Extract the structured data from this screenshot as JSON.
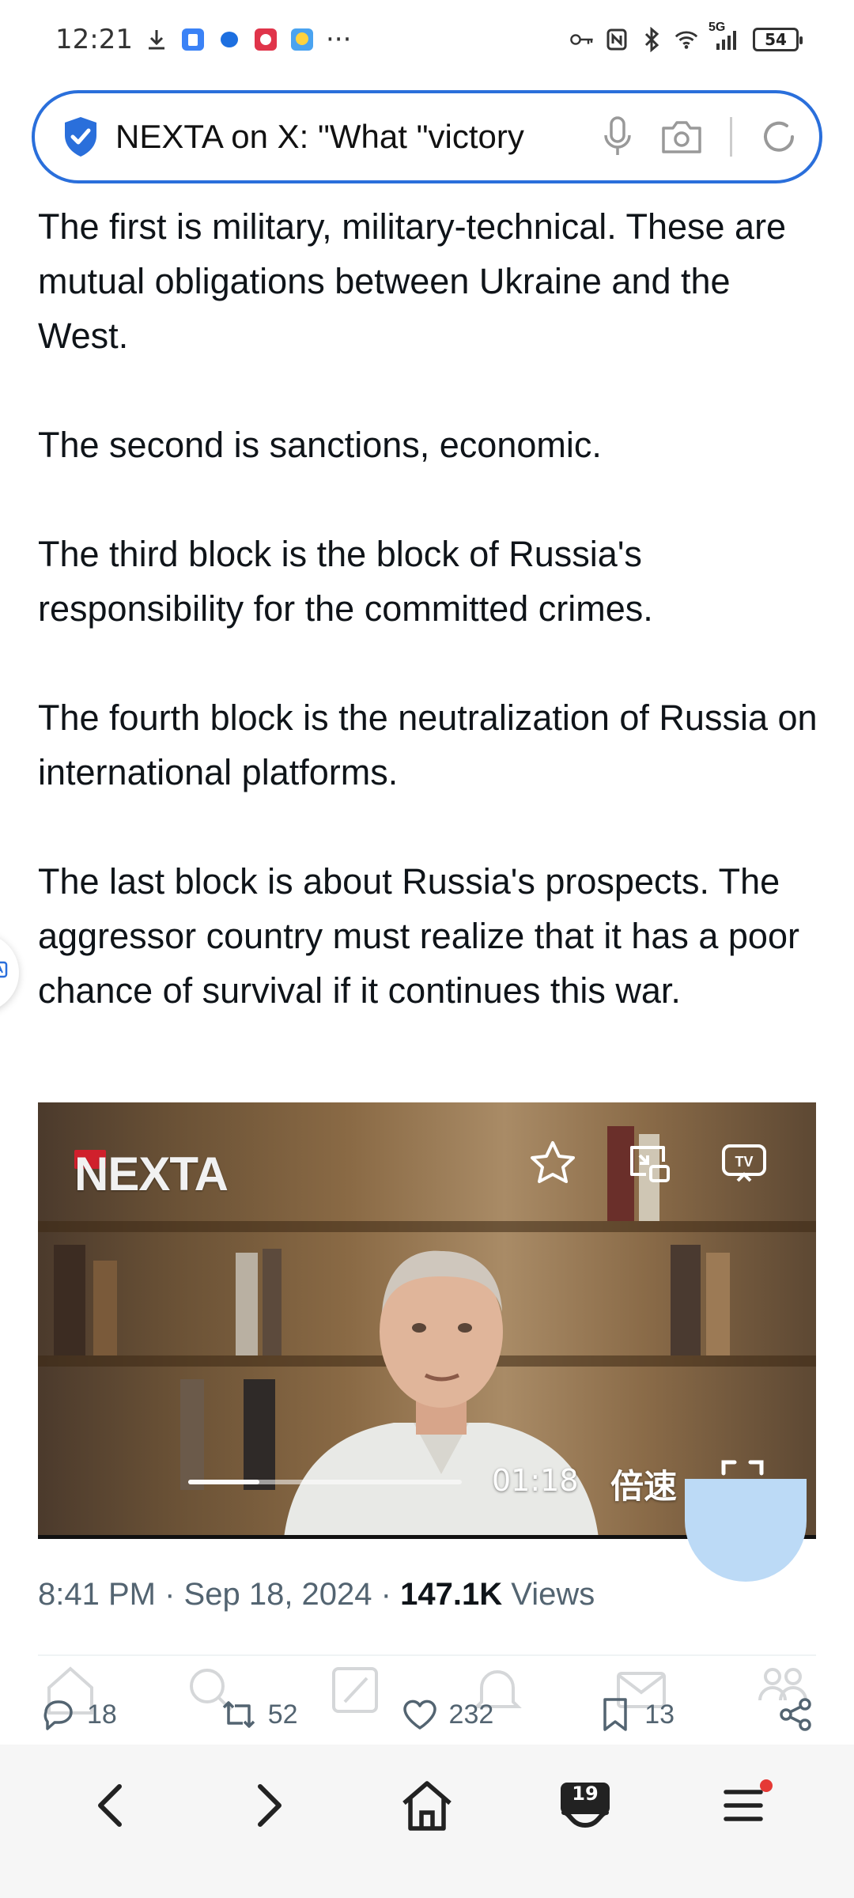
{
  "status_bar": {
    "time": "12:21",
    "more": "···",
    "network": "5G",
    "battery": "54",
    "icons": [
      "download-icon",
      "app-icon",
      "messenger-icon",
      "app-icon",
      "weather-icon",
      "key-icon",
      "nfc-icon",
      "bluetooth-icon",
      "wifi-icon",
      "signal-icon"
    ]
  },
  "url_bar": {
    "text": "NEXTA on X: \"What \"victory",
    "icons": [
      "shield-check-icon",
      "microphone-icon",
      "camera-icon",
      "reload-icon"
    ]
  },
  "article": {
    "paragraphs": [
      "The first is military, military-technical. These are mutual obligations between Ukraine and the West.",
      "The second is sanctions, economic.",
      "The third block is the block of Russia's responsibility for the committed crimes.",
      "The fourth block is the neutralization of Russia on international platforms.",
      "The last block is about Russia's prospects. The aggressor country must realize that it has a poor chance of survival if it continues this war."
    ]
  },
  "video": {
    "logo": "NEXTA",
    "time": "01:18",
    "speed_label": "倍速",
    "progress": 0.26,
    "controls": [
      "star-icon",
      "pip-icon",
      "tv-cast-icon",
      "fullscreen-icon"
    ]
  },
  "meta": {
    "time": "8:41 PM",
    "separator": "·",
    "date": "Sep 18, 2024",
    "views_count": "147.1K",
    "views_label": "Views"
  },
  "actions": {
    "replies": "18",
    "reposts": "52",
    "likes": "232",
    "bookmarks": "13"
  },
  "bottom_nav": {
    "tabs_count": "19",
    "items": [
      "back-icon",
      "forward-icon",
      "home-icon",
      "tabs-icon",
      "menu-icon"
    ]
  },
  "colors": {
    "accent": "#2a6fdb",
    "text": "#0f1419",
    "muted": "#536471",
    "notification": "#e53935"
  }
}
